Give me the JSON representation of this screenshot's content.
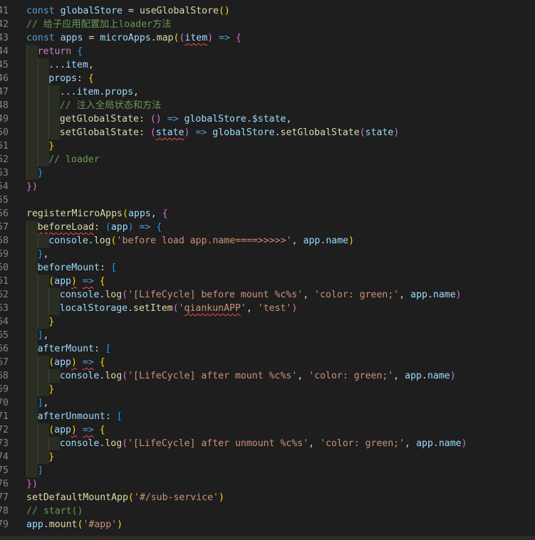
{
  "colors": {
    "background": "#1e1e1e",
    "line_number": "#858585",
    "keyword": "#569cd6",
    "variable": "#9cdcfe",
    "function": "#dcdcaa",
    "string": "#ce9178",
    "comment": "#6a9955",
    "punct": "#d4d4d4",
    "bracket_yellow": "#ffd700",
    "bracket_pink": "#da70d6",
    "bracket_blue": "#179fff"
  },
  "lines": [
    {
      "num": "41",
      "indent": 0,
      "tokens": [
        [
          "const ",
          "keyword"
        ],
        [
          "globalStore",
          "variable"
        ],
        [
          " = ",
          "punct"
        ],
        [
          "useGlobalStore",
          "function"
        ],
        [
          "()",
          "bracket_yellow"
        ]
      ]
    },
    {
      "num": "42",
      "indent": 0,
      "tokens": [
        [
          "// 给子应用配置加上loader方法",
          "comment"
        ]
      ]
    },
    {
      "num": "43",
      "indent": 0,
      "tokens": [
        [
          "const ",
          "keyword"
        ],
        [
          "apps",
          "variable"
        ],
        [
          " = ",
          "punct"
        ],
        [
          "microApps",
          "variable"
        ],
        [
          ".",
          "punct"
        ],
        [
          "map",
          "function"
        ],
        [
          "(",
          "bracket_yellow"
        ],
        [
          "(",
          "bracket_pink"
        ],
        [
          "item",
          "variable",
          "sq"
        ],
        [
          ")",
          "bracket_pink"
        ],
        [
          " ",
          "punct"
        ],
        [
          "=>",
          "keyword"
        ],
        [
          " ",
          "punct"
        ],
        [
          "{",
          "bracket_pink"
        ]
      ]
    },
    {
      "num": "44",
      "indent": 1,
      "tokens": [
        [
          "return ",
          "pink_kw"
        ],
        [
          "{",
          "bracket_blue"
        ]
      ]
    },
    {
      "num": "45",
      "indent": 2,
      "tokens": [
        [
          "...",
          "punct"
        ],
        [
          "item",
          "variable"
        ],
        [
          ",",
          "punct"
        ]
      ]
    },
    {
      "num": "46",
      "indent": 2,
      "tokens": [
        [
          "props",
          "variable"
        ],
        [
          ": ",
          "punct"
        ],
        [
          "{",
          "bracket_yellow"
        ]
      ]
    },
    {
      "num": "47",
      "indent": 3,
      "tokens": [
        [
          "...",
          "punct"
        ],
        [
          "item",
          "variable"
        ],
        [
          ".",
          "punct"
        ],
        [
          "props",
          "variable"
        ],
        [
          ",",
          "punct"
        ]
      ]
    },
    {
      "num": "48",
      "indent": 3,
      "tokens": [
        [
          "// 注入全局状态和方法",
          "comment"
        ]
      ]
    },
    {
      "num": "49",
      "indent": 3,
      "tokens": [
        [
          "getGlobalState",
          "function"
        ],
        [
          ": ",
          "punct"
        ],
        [
          "()",
          "bracket_pink"
        ],
        [
          " ",
          "punct"
        ],
        [
          "=>",
          "keyword"
        ],
        [
          " ",
          "punct"
        ],
        [
          "globalStore",
          "variable"
        ],
        [
          ".",
          "punct"
        ],
        [
          "$state",
          "variable"
        ],
        [
          ",",
          "punct"
        ]
      ]
    },
    {
      "num": "50",
      "indent": 3,
      "tokens": [
        [
          "setGlobalState",
          "function"
        ],
        [
          ": ",
          "punct"
        ],
        [
          "(",
          "bracket_pink"
        ],
        [
          "state",
          "variable",
          "sq"
        ],
        [
          ")",
          "bracket_pink"
        ],
        [
          " ",
          "punct"
        ],
        [
          "=>",
          "keyword"
        ],
        [
          " ",
          "punct"
        ],
        [
          "globalStore",
          "variable"
        ],
        [
          ".",
          "punct"
        ],
        [
          "setGlobalState",
          "function"
        ],
        [
          "(",
          "bracket_pink"
        ],
        [
          "state",
          "variable"
        ],
        [
          ")",
          "bracket_pink"
        ]
      ]
    },
    {
      "num": "51",
      "indent": 2,
      "tokens": [
        [
          "}",
          "bracket_yellow"
        ]
      ]
    },
    {
      "num": "52",
      "indent": 2,
      "tokens": [
        [
          "// loader",
          "comment"
        ]
      ]
    },
    {
      "num": "53",
      "indent": 1,
      "tokens": [
        [
          "}",
          "bracket_blue"
        ]
      ]
    },
    {
      "num": "54",
      "indent": 0,
      "tokens": [
        [
          "})",
          "bracket_pink"
        ]
      ]
    },
    {
      "num": "55",
      "indent": 0,
      "tokens": []
    },
    {
      "num": "56",
      "indent": 0,
      "tokens": [
        [
          "registerMicroApps",
          "function"
        ],
        [
          "(",
          "bracket_yellow"
        ],
        [
          "apps",
          "variable"
        ],
        [
          ", ",
          "punct"
        ],
        [
          "{",
          "bracket_pink"
        ]
      ]
    },
    {
      "num": "57",
      "indent": 1,
      "tokens": [
        [
          "beforeLoad",
          "function",
          "sq"
        ],
        [
          ": ",
          "punct"
        ],
        [
          "(",
          "bracket_blue"
        ],
        [
          "app",
          "variable"
        ],
        [
          ")",
          "bracket_blue"
        ],
        [
          " ",
          "punct"
        ],
        [
          "=>",
          "keyword"
        ],
        [
          " ",
          "punct"
        ],
        [
          "{",
          "bracket_blue"
        ]
      ]
    },
    {
      "num": "58",
      "indent": 2,
      "tokens": [
        [
          "console",
          "variable"
        ],
        [
          ".",
          "punct"
        ],
        [
          "log",
          "function"
        ],
        [
          "(",
          "bracket_yellow"
        ],
        [
          "'before load app.name====>>>>>'",
          "string"
        ],
        [
          ", ",
          "punct"
        ],
        [
          "app",
          "variable"
        ],
        [
          ".",
          "punct"
        ],
        [
          "name",
          "variable"
        ],
        [
          ")",
          "bracket_yellow"
        ]
      ]
    },
    {
      "num": "59",
      "indent": 1,
      "tokens": [
        [
          "}",
          "bracket_blue"
        ],
        [
          ",",
          "punct"
        ]
      ]
    },
    {
      "num": "60",
      "indent": 1,
      "tokens": [
        [
          "beforeMount",
          "variable"
        ],
        [
          ": ",
          "punct"
        ],
        [
          "[",
          "bracket_blue"
        ]
      ]
    },
    {
      "num": "61",
      "indent": 2,
      "tokens": [
        [
          "(",
          "bracket_yellow"
        ],
        [
          "app",
          "variable"
        ],
        [
          ")",
          "bracket_yellow",
          "sq"
        ],
        [
          " ",
          "punct"
        ],
        [
          "=>",
          "keyword",
          "sq"
        ],
        [
          " ",
          "punct"
        ],
        [
          "{",
          "bracket_yellow"
        ]
      ]
    },
    {
      "num": "62",
      "indent": 3,
      "tokens": [
        [
          "console",
          "variable"
        ],
        [
          ".",
          "punct"
        ],
        [
          "log",
          "function"
        ],
        [
          "(",
          "bracket_pink"
        ],
        [
          "'[LifeCycle] before mount %c%s'",
          "string"
        ],
        [
          ", ",
          "punct"
        ],
        [
          "'color: green;'",
          "string"
        ],
        [
          ", ",
          "punct"
        ],
        [
          "app",
          "variable"
        ],
        [
          ".",
          "punct"
        ],
        [
          "name",
          "variable"
        ],
        [
          ")",
          "bracket_pink"
        ]
      ]
    },
    {
      "num": "63",
      "indent": 3,
      "tokens": [
        [
          "localStorage",
          "variable"
        ],
        [
          ".",
          "punct"
        ],
        [
          "setItem",
          "function"
        ],
        [
          "(",
          "bracket_pink"
        ],
        [
          "'",
          "string"
        ],
        [
          "qiankunAPP",
          "string",
          "sq"
        ],
        [
          "'",
          "string"
        ],
        [
          ", ",
          "punct"
        ],
        [
          "'test'",
          "string"
        ],
        [
          ")",
          "bracket_pink"
        ]
      ]
    },
    {
      "num": "64",
      "indent": 2,
      "tokens": [
        [
          "}",
          "bracket_yellow"
        ]
      ]
    },
    {
      "num": "65",
      "indent": 1,
      "tokens": [
        [
          "]",
          "bracket_blue"
        ],
        [
          ",",
          "punct"
        ]
      ]
    },
    {
      "num": "66",
      "indent": 1,
      "tokens": [
        [
          "afterMount",
          "variable"
        ],
        [
          ": ",
          "punct"
        ],
        [
          "[",
          "bracket_blue"
        ]
      ]
    },
    {
      "num": "67",
      "indent": 2,
      "tokens": [
        [
          "(",
          "bracket_yellow"
        ],
        [
          "app",
          "variable"
        ],
        [
          ")",
          "bracket_yellow",
          "sq"
        ],
        [
          " ",
          "punct"
        ],
        [
          "=>",
          "keyword",
          "sq"
        ],
        [
          " ",
          "punct"
        ],
        [
          "{",
          "bracket_yellow"
        ]
      ]
    },
    {
      "num": "68",
      "indent": 3,
      "tokens": [
        [
          "console",
          "variable"
        ],
        [
          ".",
          "punct"
        ],
        [
          "log",
          "function"
        ],
        [
          "(",
          "bracket_pink"
        ],
        [
          "'[LifeCycle] after mount %c%s'",
          "string"
        ],
        [
          ", ",
          "punct"
        ],
        [
          "'color: green;'",
          "string"
        ],
        [
          ", ",
          "punct"
        ],
        [
          "app",
          "variable"
        ],
        [
          ".",
          "punct"
        ],
        [
          "name",
          "variable"
        ],
        [
          ")",
          "bracket_pink"
        ]
      ]
    },
    {
      "num": "69",
      "indent": 2,
      "tokens": [
        [
          "}",
          "bracket_yellow"
        ]
      ]
    },
    {
      "num": "70",
      "indent": 1,
      "tokens": [
        [
          "]",
          "bracket_blue"
        ],
        [
          ",",
          "punct"
        ]
      ]
    },
    {
      "num": "71",
      "indent": 1,
      "tokens": [
        [
          "afterUnmount",
          "variable"
        ],
        [
          ": ",
          "punct"
        ],
        [
          "[",
          "bracket_blue"
        ]
      ]
    },
    {
      "num": "72",
      "indent": 2,
      "tokens": [
        [
          "(",
          "bracket_yellow"
        ],
        [
          "app",
          "variable"
        ],
        [
          ")",
          "bracket_yellow",
          "sq"
        ],
        [
          " ",
          "punct"
        ],
        [
          "=>",
          "keyword",
          "sq"
        ],
        [
          " ",
          "punct"
        ],
        [
          "{",
          "bracket_yellow"
        ]
      ]
    },
    {
      "num": "73",
      "indent": 3,
      "tokens": [
        [
          "console",
          "variable"
        ],
        [
          ".",
          "punct"
        ],
        [
          "log",
          "function"
        ],
        [
          "(",
          "bracket_pink"
        ],
        [
          "'[LifeCycle] after unmount %c%s'",
          "string"
        ],
        [
          ", ",
          "punct"
        ],
        [
          "'color: green;'",
          "string"
        ],
        [
          ", ",
          "punct"
        ],
        [
          "app",
          "variable"
        ],
        [
          ".",
          "punct"
        ],
        [
          "name",
          "variable"
        ],
        [
          ")",
          "bracket_pink"
        ]
      ]
    },
    {
      "num": "74",
      "indent": 2,
      "tokens": [
        [
          "}",
          "bracket_yellow"
        ]
      ]
    },
    {
      "num": "75",
      "indent": 1,
      "tokens": [
        [
          "]",
          "bracket_blue"
        ]
      ]
    },
    {
      "num": "76",
      "indent": 0,
      "tokens": [
        [
          "})",
          "bracket_pink"
        ]
      ]
    },
    {
      "num": "77",
      "indent": 0,
      "tokens": [
        [
          "setDefaultMountApp",
          "function"
        ],
        [
          "(",
          "bracket_yellow"
        ],
        [
          "'#/sub-service'",
          "string"
        ],
        [
          ")",
          "bracket_yellow"
        ]
      ]
    },
    {
      "num": "78",
      "indent": 0,
      "tokens": [
        [
          "// start()",
          "comment"
        ]
      ]
    },
    {
      "num": "79",
      "indent": 0,
      "tokens": [
        [
          "app",
          "variable"
        ],
        [
          ".",
          "punct"
        ],
        [
          "mount",
          "function"
        ],
        [
          "(",
          "bracket_yellow"
        ],
        [
          "'#app'",
          "string"
        ],
        [
          ")",
          "bracket_yellow"
        ]
      ]
    }
  ]
}
